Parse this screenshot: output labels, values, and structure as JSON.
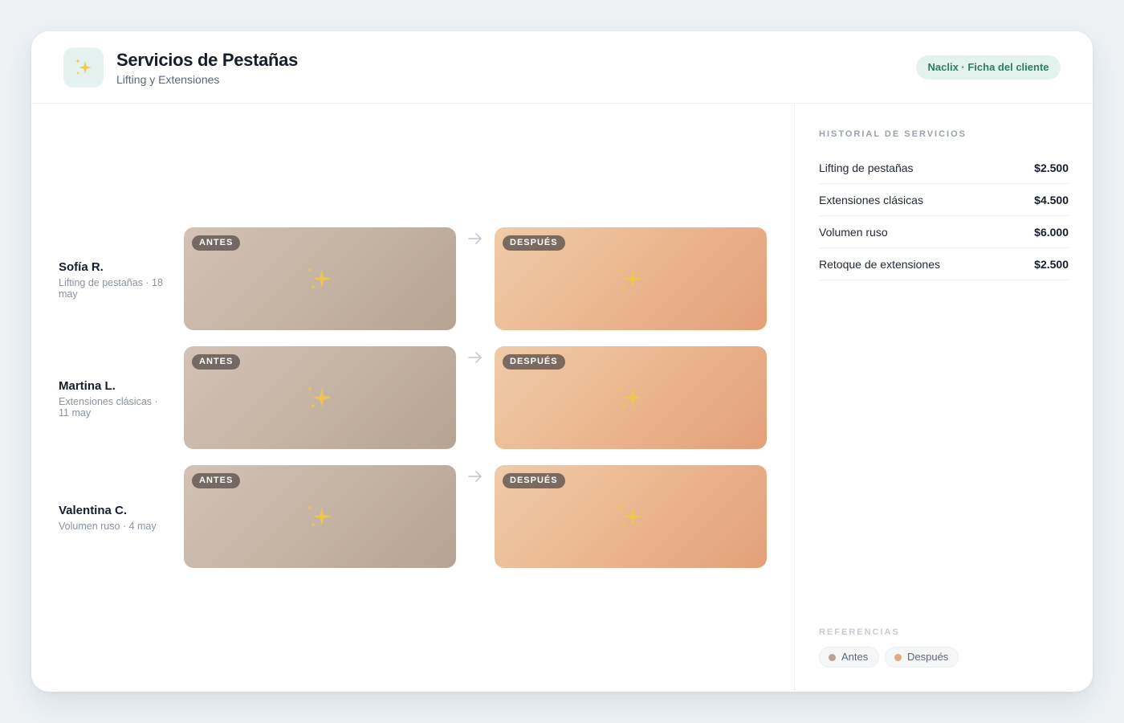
{
  "header": {
    "title": "Servicios de Pestañas",
    "subtitle": "Lifting y Extensiones",
    "badge": "Naclix · Ficha del cliente",
    "logo_icon": "sparkles-icon"
  },
  "comparisons": {
    "before_label": "ANTES",
    "after_label": "DESPUÉS",
    "rows": [
      {
        "name": "Sofía R.",
        "detail": "Lifting de pestañas · 18 may"
      },
      {
        "name": "Martina L.",
        "detail": "Extensiones clásicas · 11 may"
      },
      {
        "name": "Valentina C.",
        "detail": "Volumen ruso · 4 may"
      }
    ]
  },
  "sidebar": {
    "history_heading": "HISTORIAL DE SERVICIOS",
    "services": [
      {
        "name": "Lifting de pestañas",
        "price": "$2.500"
      },
      {
        "name": "Extensiones clásicas",
        "price": "$4.500"
      },
      {
        "name": "Volumen ruso",
        "price": "$6.000"
      },
      {
        "name": "Retoque de extensiones",
        "price": "$2.500"
      }
    ],
    "references_heading": "REFERENCIAS",
    "legend": [
      {
        "label": "Antes",
        "color": "#b8a496"
      },
      {
        "label": "Después",
        "color": "#e7a57b"
      }
    ]
  },
  "colors": {
    "accent": "#2a7e63",
    "before_tone": "#c5b3a4",
    "after_tone": "#eab48c",
    "sparkle": "#f0c84a"
  }
}
